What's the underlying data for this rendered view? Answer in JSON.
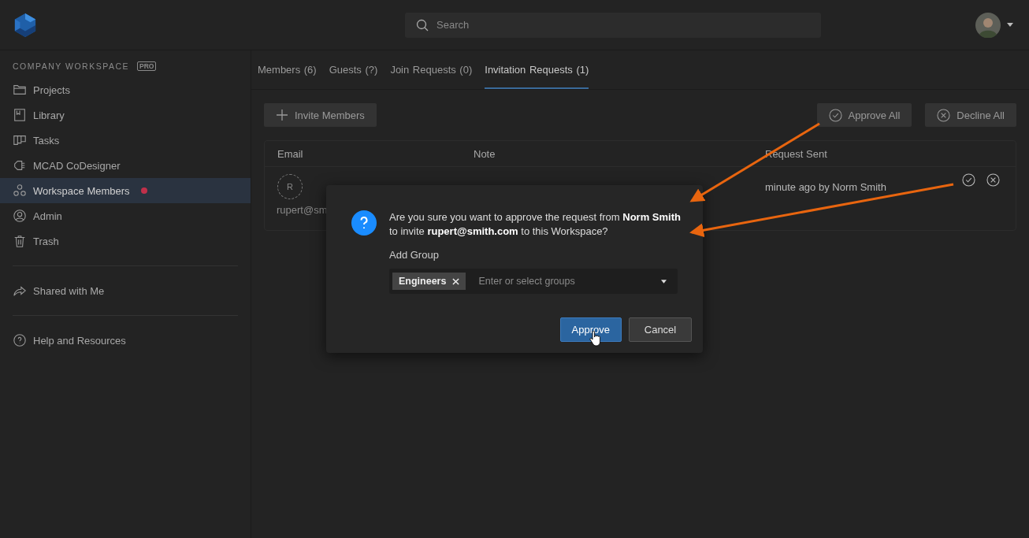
{
  "search": {
    "placeholder": "Search"
  },
  "sidebar": {
    "workspace": "COMPANY WORKSPACE",
    "badge": "PRO",
    "sections": [
      [
        {
          "label": "Projects",
          "selected": false,
          "notify": false
        },
        {
          "label": "Library",
          "selected": false,
          "notify": false
        },
        {
          "label": "Tasks",
          "selected": false,
          "notify": false
        },
        {
          "label": "MCAD CoDesigner",
          "selected": false,
          "notify": false
        },
        {
          "label": "Workspace Members",
          "selected": true,
          "notify": true
        },
        {
          "label": "Admin",
          "selected": false,
          "notify": false
        },
        {
          "label": "Trash",
          "selected": false,
          "notify": false
        }
      ],
      [
        {
          "label": "Shared with Me",
          "selected": false,
          "notify": false
        }
      ],
      [
        {
          "label": "Help and Resources",
          "selected": false,
          "notify": false
        }
      ]
    ]
  },
  "tabs": [
    {
      "label": "Members",
      "count": "(6)",
      "selected": false
    },
    {
      "label": "Guests",
      "count": "(?)",
      "selected": false
    },
    {
      "label": "Join Requests",
      "count": "(0)",
      "selected": false
    },
    {
      "label": "Invitation Requests",
      "count": "(1)",
      "selected": true
    }
  ],
  "toolbar": {
    "invite": "Invite Members",
    "approve_all": "Approve All",
    "decline_all": "Decline All"
  },
  "table": {
    "columns": [
      "Email",
      "Note",
      "Request Sent"
    ],
    "rows": [
      {
        "initial": "R",
        "email": "rupert@sm",
        "request_sent": "minute ago by Norm Smith"
      }
    ]
  },
  "dialog": {
    "message": "Are you sure you want to approve the request from **Norm Smith** to invite **rupert@smith.com** to this Workspace?",
    "group_label": "Add Group",
    "tags": [
      "Engineers"
    ],
    "placeholder": "Enter or select groups",
    "buttons": [
      {
        "label": "Approve",
        "kind": "primary"
      },
      {
        "label": "Cancel",
        "kind": "secondary"
      }
    ]
  }
}
